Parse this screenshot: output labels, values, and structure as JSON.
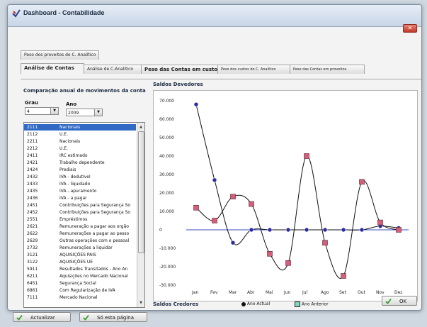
{
  "window": {
    "title": "Dashboard - Contabilidade"
  },
  "tabs_row1": [
    {
      "label": "Peso dos proveitos do C. Analítico"
    }
  ],
  "tabs_row2": [
    {
      "label": "Análise de Contas",
      "active": true
    },
    {
      "label": "Análise de C.Analítico"
    },
    {
      "label": "Peso das Contas em custos"
    },
    {
      "label": "Peso dos custos do C. Analítico"
    },
    {
      "label": "Peso das Contas em proveitos"
    }
  ],
  "left": {
    "section_title": "Comparação anual de movimentos da conta",
    "grau_label": "Grau",
    "grau_value": "4",
    "ano_label": "Ano",
    "ano_value": "2009",
    "accounts": [
      {
        "code": "2111",
        "name": "Nacionais",
        "selected": true
      },
      {
        "code": "2112",
        "name": "U.E."
      },
      {
        "code": "2211",
        "name": "Nacionais"
      },
      {
        "code": "2212",
        "name": "U.E."
      },
      {
        "code": "2411",
        "name": "IRC estimado"
      },
      {
        "code": "2421",
        "name": "Trabalho dependente"
      },
      {
        "code": "2424",
        "name": "Prediais"
      },
      {
        "code": "2432",
        "name": "IVA - dedutível"
      },
      {
        "code": "2433",
        "name": "IVA - liquidado"
      },
      {
        "code": "2435",
        "name": "IVA - apuramento"
      },
      {
        "code": "2436",
        "name": "IVA - a pagar"
      },
      {
        "code": "2451",
        "name": "Contribuições para Segurança So"
      },
      {
        "code": "2452",
        "name": "Contribuições para Segurança So"
      },
      {
        "code": "2551",
        "name": "Empréstimos"
      },
      {
        "code": "2621",
        "name": "Remuneração a pagar aos orgão"
      },
      {
        "code": "2622",
        "name": "Remunerações a pagar ao pesso"
      },
      {
        "code": "2629",
        "name": "Outras operações com o pessoal"
      },
      {
        "code": "2732",
        "name": "Remunerações a liquidar"
      },
      {
        "code": "3121",
        "name": "AQUISIÇÕES PAIS"
      },
      {
        "code": "3122",
        "name": "AQUISIÇÕES UE"
      },
      {
        "code": "5911",
        "name": "Resultados Transitados - Ano An"
      },
      {
        "code": "6211",
        "name": "Aquisições no Mercado Nacional"
      },
      {
        "code": "6451",
        "name": "Segurança Social"
      },
      {
        "code": "6861",
        "name": "Com Regularização de IVA"
      },
      {
        "code": "7111",
        "name": "Mercado Nacional"
      }
    ]
  },
  "chart_header": {
    "top_label": "Saldos Devedores",
    "bottom_label": "Saldos Credores"
  },
  "buttons": {
    "refresh": "Actualizar",
    "this_page": "Só esta página",
    "ok": "OK"
  },
  "chart_data": {
    "type": "line",
    "categories": [
      "Jan",
      "Fev",
      "Mar",
      "Abr",
      "Mai",
      "Jun",
      "Jul",
      "Ago",
      "Set",
      "Out",
      "Nov",
      "Dez"
    ],
    "y_ticks": [
      "70.000",
      "60.000",
      "50.000",
      "40.000",
      "30.000",
      "20.000",
      "10.000",
      "0",
      "-10.000",
      "-20.000",
      "-30.000"
    ],
    "ylim": [
      -30000,
      70000
    ],
    "series": [
      {
        "name": "Ano Actual",
        "marker": "circle",
        "color": "#2a2aa8",
        "values": [
          68000,
          27000,
          -7000,
          0,
          0,
          0,
          0,
          0,
          0,
          0,
          2000,
          1000
        ]
      },
      {
        "name": "Ano Anterior",
        "marker": "square",
        "color": "#d2607a",
        "values": [
          12000,
          5000,
          18000,
          14000,
          -13000,
          -18000,
          40000,
          -7000,
          -25000,
          26000,
          4000,
          0
        ]
      }
    ],
    "legend_position": "bottom"
  }
}
